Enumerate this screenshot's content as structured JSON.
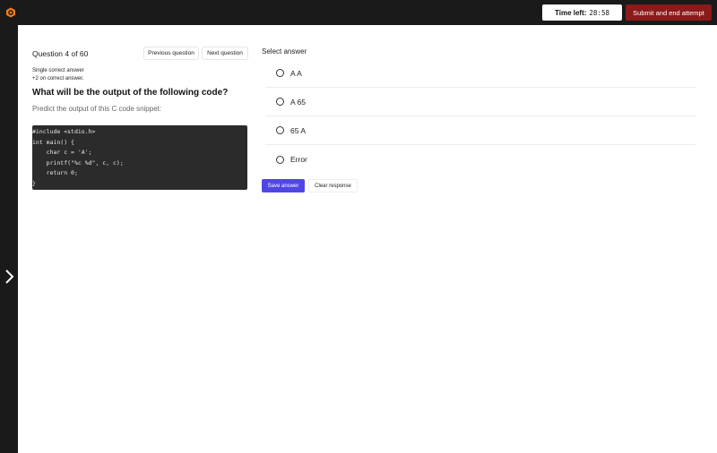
{
  "header": {
    "logo_icon": "cube-logo-icon",
    "timer_label": "Time left:",
    "timer_value": "28:58",
    "submit_label": "Submit and end attempt",
    "submit_color": "#8b1a1a"
  },
  "sidebar": {
    "expand_icon": "chevron-right-icon"
  },
  "question": {
    "counter": "Question 4 of 60",
    "prev_label": "Previous question",
    "next_label": "Next question",
    "type": "Single correct answer",
    "marks": "+2 on correct answer.",
    "title": "What will be the output of the following code?",
    "subtitle": "Predict the output of this C code snippet:",
    "code_lines": [
      "#include <stdio.h>",
      "int main() {",
      "    char c = 'A';",
      "    printf(\"%c %d\", c, c);",
      "    return 0;",
      "}"
    ]
  },
  "answer": {
    "label": "Select answer",
    "options": [
      "A A",
      "A 65",
      "65 A",
      "Error"
    ],
    "save_label": "Save answer",
    "clear_label": "Clear response",
    "save_color": "#5046e5"
  }
}
